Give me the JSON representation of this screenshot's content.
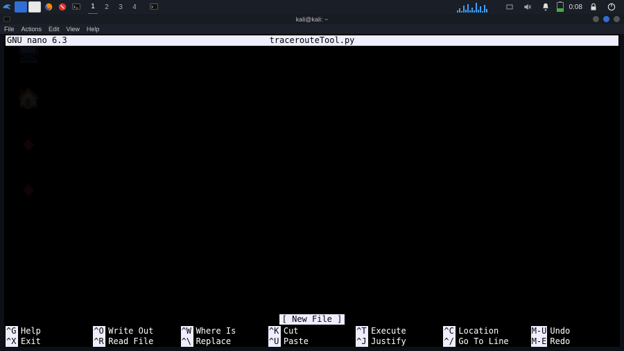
{
  "panel": {
    "workspaces": [
      "1",
      "2",
      "3",
      "4"
    ],
    "active_workspace": 0,
    "clock": "0:08",
    "battery_pct": 35
  },
  "window": {
    "title": "kali@kali: ~",
    "menus": [
      "File",
      "Actions",
      "Edit",
      "View",
      "Help"
    ]
  },
  "nano": {
    "app": "GNU nano 6.3",
    "file": "tracerouteTool.py",
    "status": "[ New File ]",
    "rows": [
      [
        {
          "key": "^G",
          "label": "Help"
        },
        {
          "key": "^O",
          "label": "Write Out"
        },
        {
          "key": "^W",
          "label": "Where Is"
        },
        {
          "key": "^K",
          "label": "Cut"
        },
        {
          "key": "^T",
          "label": "Execute"
        },
        {
          "key": "^C",
          "label": "Location"
        },
        {
          "key": "M-U",
          "label": "Undo"
        }
      ],
      [
        {
          "key": "^X",
          "label": "Exit"
        },
        {
          "key": "^R",
          "label": "Read File"
        },
        {
          "key": "^\\",
          "label": "Replace"
        },
        {
          "key": "^U",
          "label": "Paste"
        },
        {
          "key": "^J",
          "label": "Justify"
        },
        {
          "key": "^/",
          "label": "Go To Line"
        },
        {
          "key": "M-E",
          "label": "Redo"
        }
      ]
    ]
  }
}
